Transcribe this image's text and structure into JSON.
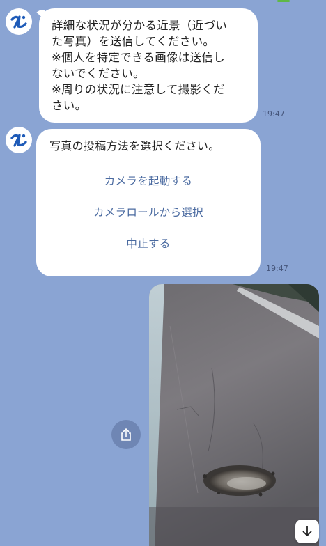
{
  "colors": {
    "background": "#8aa4d3",
    "bubble": "#ffffff",
    "option_text": "#4a6aa0",
    "share_button": "#6f86b4"
  },
  "message1": {
    "lines": [
      "詳細な状況が分かる近景（近づい",
      "た写真）を送信してください。",
      "※個人を特定できる画像は送信し",
      "ないでください。",
      "※周りの状況に注意して撮影くだ",
      "さい。"
    ],
    "time": "19:47"
  },
  "message2": {
    "title": "写真の投稿方法を選択ください。",
    "options": [
      "カメラを起動する",
      "カメラロールから選択",
      "中止する"
    ],
    "time": "19:47"
  },
  "photo": {
    "description_icon": "pothole-photo"
  },
  "icons": {
    "avatar": "bot-avatar-icon",
    "share": "share-icon",
    "scroll": "arrow-down-icon"
  }
}
